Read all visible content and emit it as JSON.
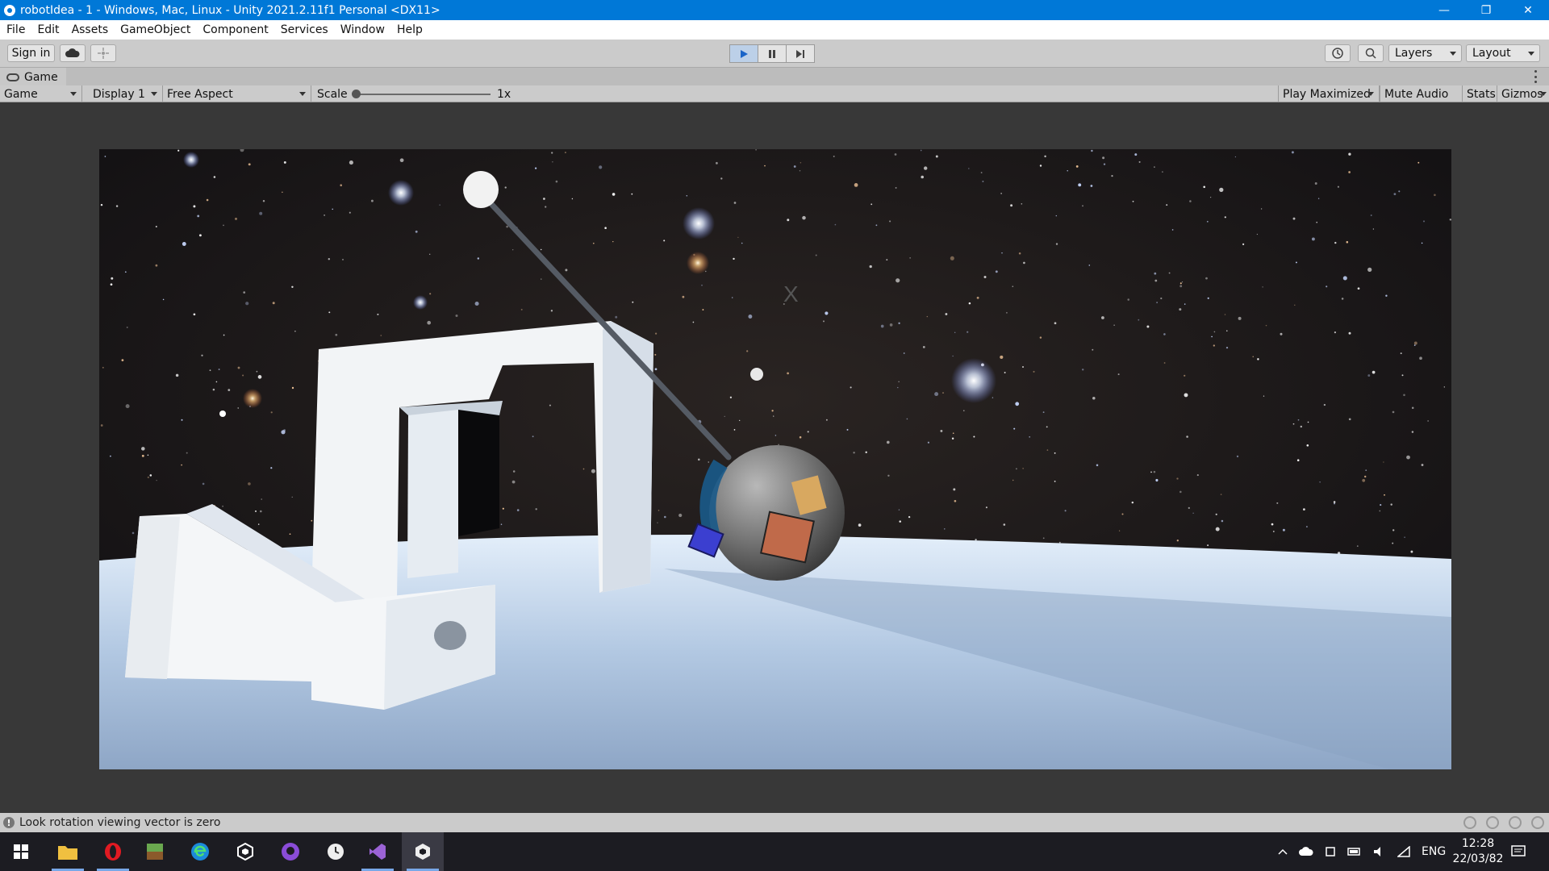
{
  "window": {
    "title": "robotIdea - 1 - Windows, Mac, Linux - Unity 2021.2.11f1 Personal <DX11>",
    "minimize_glyph": "—",
    "restore_glyph": "❐",
    "close_glyph": "✕"
  },
  "menu": [
    "File",
    "Edit",
    "Assets",
    "GameObject",
    "Component",
    "Services",
    "Window",
    "Help"
  ],
  "toolbar": {
    "sign_in": "Sign in",
    "layers": "Layers",
    "layout": "Layout"
  },
  "tab": {
    "label": "Game"
  },
  "game_toolbar": {
    "view_mode": "Game",
    "display": "Display 1",
    "aspect": "Free Aspect",
    "scale_label": "Scale",
    "scale_value": "1x",
    "play_mode": "Play Maximized",
    "mute_audio": "Mute Audio",
    "stats": "Stats",
    "gizmos": "Gizmos"
  },
  "status": {
    "message": "Look rotation viewing vector is zero"
  },
  "taskbar": {
    "apps": [
      "file-explorer",
      "opera",
      "minecraft",
      "edge",
      "unity-hub",
      "github-desktop",
      "clock-app",
      "visual-studio",
      "unity-editor"
    ],
    "tray_language": "ENG",
    "time": "12:28",
    "date": "22/03/82"
  },
  "colors": {
    "titlebar": "#0078d7",
    "play_active": "#bcd0e8",
    "taskbar": "#1c1c22"
  }
}
